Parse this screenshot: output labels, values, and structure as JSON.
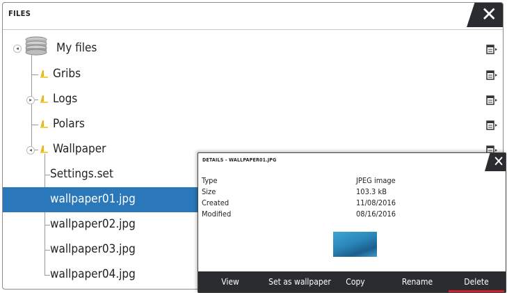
{
  "window": {
    "title": "FILES"
  },
  "tree": {
    "root": {
      "label": "My files"
    },
    "items": [
      {
        "label": "Gribs"
      },
      {
        "label": "Logs"
      },
      {
        "label": "Polars"
      },
      {
        "label": "Wallpaper"
      },
      {
        "label": "Settings.set"
      },
      {
        "label": "wallpaper01.jpg",
        "selected": true
      },
      {
        "label": "wallpaper02.jpg"
      },
      {
        "label": "wallpaper03.jpg"
      },
      {
        "label": "wallpaper04.jpg"
      }
    ]
  },
  "details": {
    "title": "DETAILS - WALLPAPER01.JPG",
    "fields": [
      {
        "label": "Type",
        "value": "JPEG image"
      },
      {
        "label": "Size",
        "value": "103.3 kB"
      },
      {
        "label": "Created",
        "value": "11/08/2016"
      },
      {
        "label": "Modified",
        "value": "08/16/2016"
      }
    ],
    "actions": [
      "View",
      "Set as wallpaper",
      "Copy",
      "Rename",
      "Delete"
    ]
  },
  "colors": {
    "selection": "#2a78ba",
    "bar": "#2a2c30",
    "accent": "#d0202a"
  },
  "icons": {
    "close": "close-icon",
    "menu": "menu-icon",
    "folder": "folder-icon",
    "storage": "storage-icon"
  }
}
